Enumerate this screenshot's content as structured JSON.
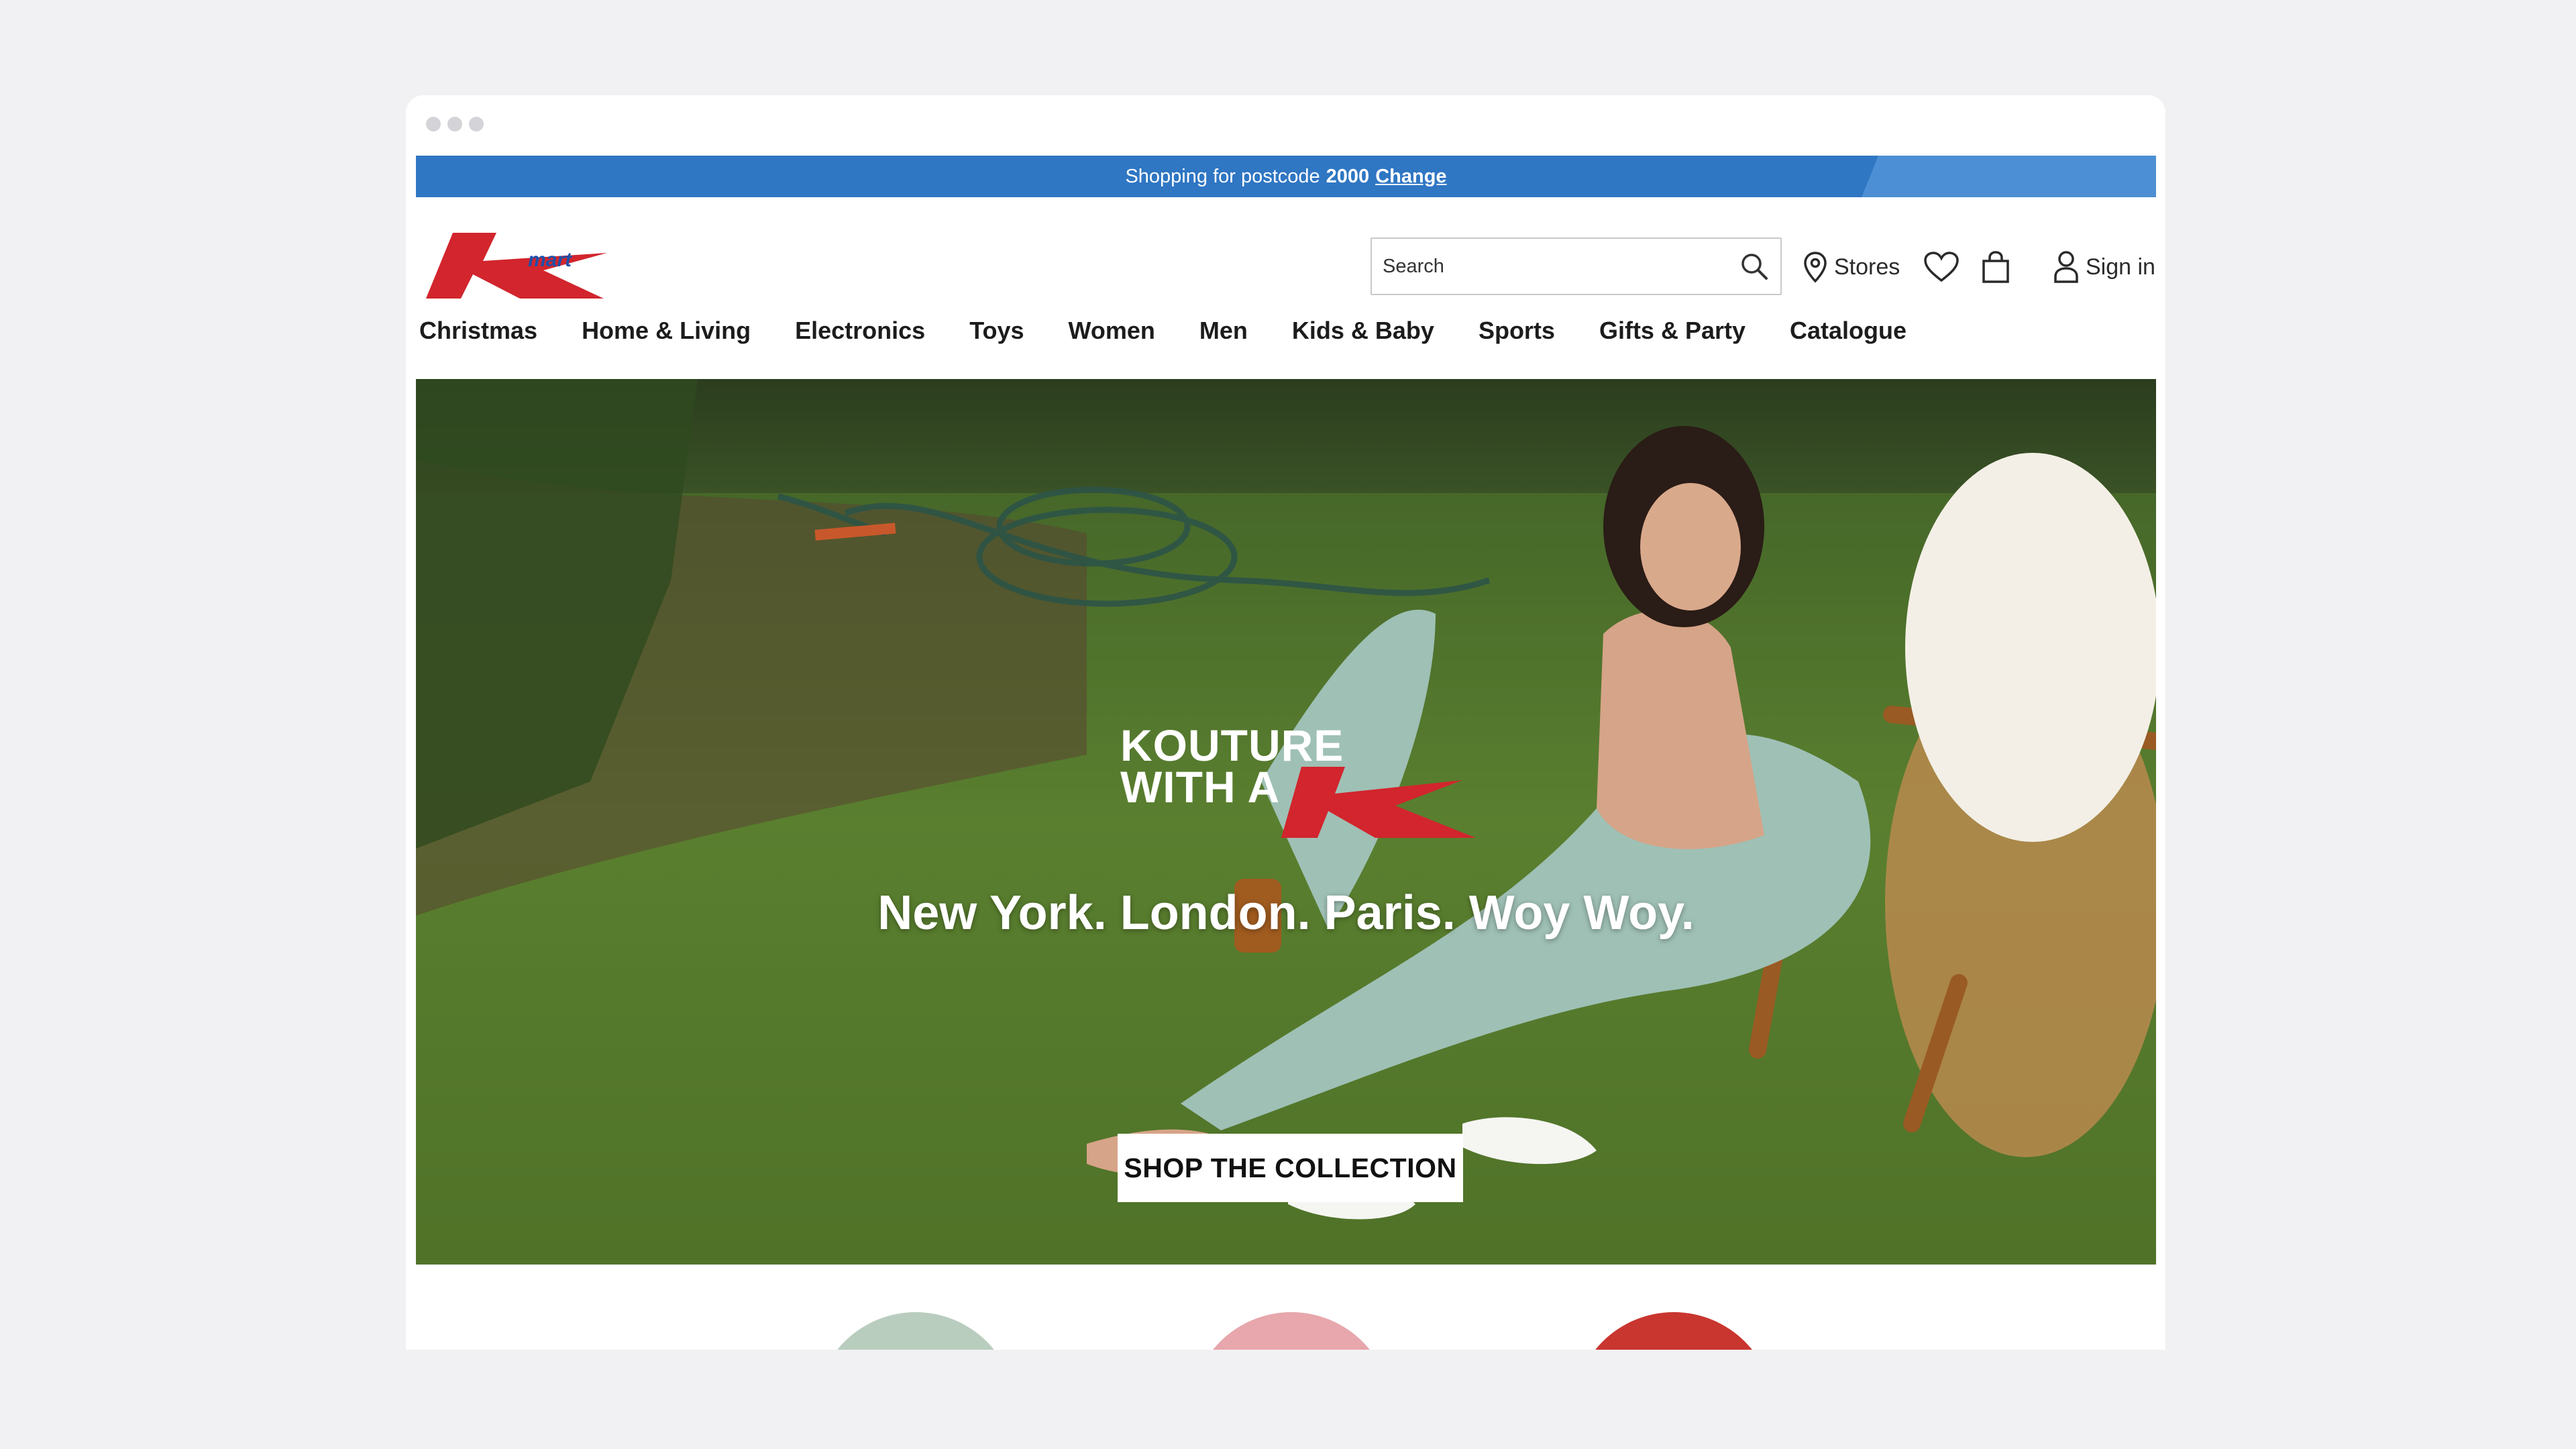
{
  "promo": {
    "prefix": "Shopping for postcode",
    "postcode": "2000",
    "change_label": "Change"
  },
  "brand": {
    "logo_word": "mart",
    "red": "#d2252d",
    "blue": "#2f76c3"
  },
  "search": {
    "placeholder": "Search"
  },
  "header": {
    "stores_label": "Stores",
    "signin_label": "Sign in"
  },
  "nav": {
    "items": [
      "Christmas",
      "Home & Living",
      "Electronics",
      "Toys",
      "Women",
      "Men",
      "Kids & Baby",
      "Sports",
      "Gifts & Party",
      "Catalogue"
    ]
  },
  "hero": {
    "headline_line1": "KOUTURE",
    "headline_line2": "WITH A",
    "tagline": "New York. London. Paris. Woy Woy.",
    "cta_label": "SHOP THE COLLECTION"
  },
  "icons": {
    "search": "search-icon",
    "stores": "map-pin-icon",
    "wishlist": "heart-icon",
    "cart": "shopping-bag-icon",
    "account": "user-icon"
  }
}
